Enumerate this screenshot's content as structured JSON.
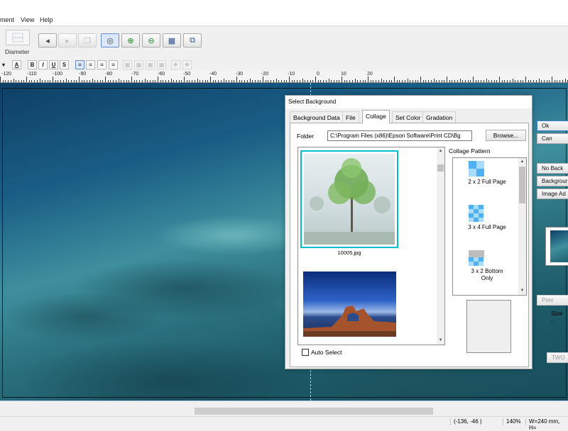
{
  "menu": {
    "items": [
      "ment",
      "View",
      "Help"
    ]
  },
  "toolbar": {
    "diameter_label": "Diameter"
  },
  "format_bar": {
    "buttons": [
      "A",
      "B",
      "I",
      "U",
      "S"
    ]
  },
  "ruler": {
    "labels": [
      "-120",
      "-110",
      "-100",
      "-90",
      "-80",
      "-70",
      "-60",
      "-50",
      "-40",
      "-30",
      "-20",
      "-10",
      "0",
      "10",
      "20"
    ]
  },
  "dialog": {
    "title": "Select Background",
    "tabs": [
      "Background Data",
      "File",
      "Collage",
      "Set Color",
      "Gradation"
    ],
    "selected_tab": "Collage",
    "folder_label": "Folder",
    "folder_path": "C:\\Program Files (x86)\\Epson Software\\Print CD\\Bg",
    "browse_label": "Browse...",
    "image_1_name": "10005.jpg",
    "auto_select_label": "Auto Select",
    "pattern_label": "Collage Pattern",
    "patterns": [
      "2 x 2 Full Page",
      "3 x 4 Full Page",
      "3 x 2 Bottom Only"
    ]
  },
  "side": {
    "buttons": [
      "Ok",
      "Can",
      "No Back",
      "Backgrour",
      "Image Ad",
      "Prev",
      "TWO"
    ],
    "size_label": "Size",
    "size_value": "-"
  },
  "status": {
    "coords": "(-136, -46 )",
    "zoom": "140%",
    "dims": "W=240 mm, H="
  }
}
